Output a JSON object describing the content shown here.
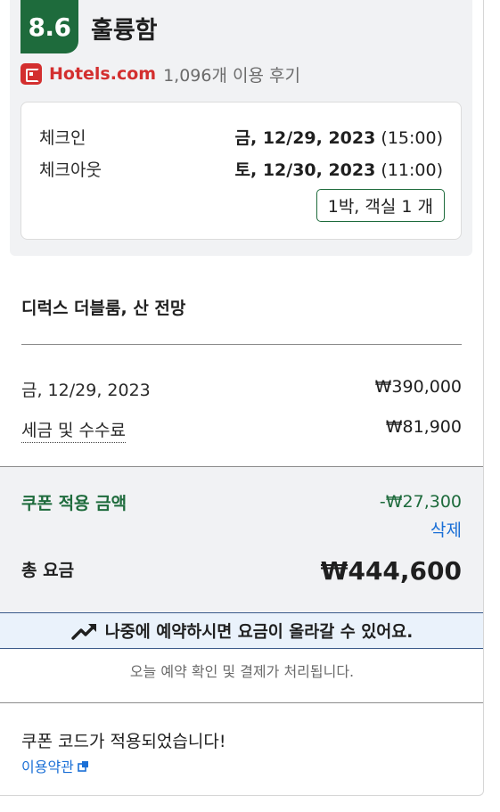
{
  "rating": {
    "score": "8.6",
    "word": "훌륭함"
  },
  "source": {
    "brand": "Hotels.com",
    "reviews": "1,096개 이용 후기"
  },
  "stay": {
    "checkin_label": "체크인",
    "checkin_date": "금, 12/29, 2023",
    "checkin_time": "(15:00)",
    "checkout_label": "체크아웃",
    "checkout_date": "토, 12/30, 2023",
    "checkout_time": "(11:00)",
    "summary": "1박, 객실 1 개"
  },
  "room": {
    "name": "디럭스 더블룸, 산 전망"
  },
  "charges": [
    {
      "label": "금, 12/29, 2023",
      "amount": "₩390,000"
    },
    {
      "label": "세금 및 수수료",
      "amount": "₩81,900"
    }
  ],
  "coupon": {
    "label": "쿠폰 적용 금액",
    "amount": "-₩27,300",
    "remove_label": "삭제"
  },
  "total": {
    "label": "총 요금",
    "amount": "₩444,600"
  },
  "warning": {
    "text": "나중에 예약하시면 요금이 올라갈 수 있어요.",
    "icon": "trending-up-icon"
  },
  "payment_note": "오늘 예약 확인 및 결제가 처리됩니다.",
  "coupon_applied": {
    "message": "쿠폰 코드가 적용되었습니다!",
    "terms_link": "이용약관"
  },
  "colors": {
    "brand_green": "#1e6b3c",
    "hotels_red": "#d32f2f",
    "link_blue": "#1a6fd6"
  }
}
